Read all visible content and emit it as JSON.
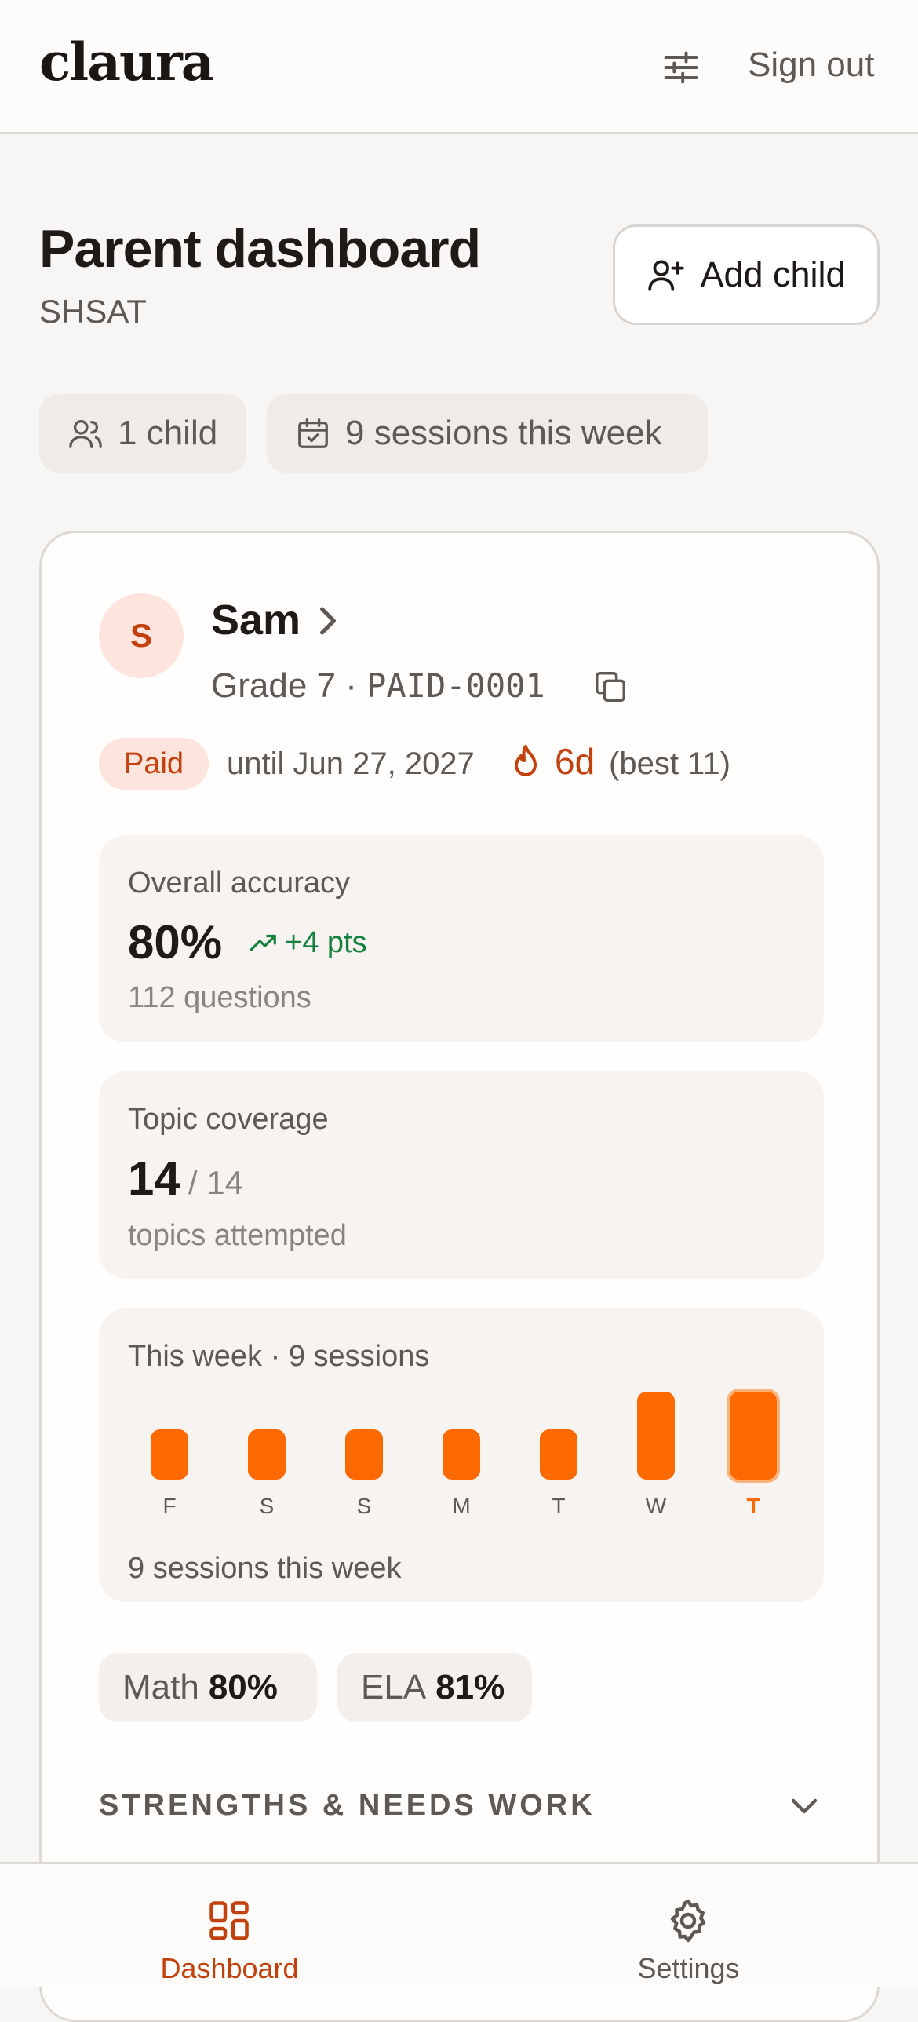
{
  "app": {
    "logo": "claura",
    "sign_out": "Sign out"
  },
  "header": {
    "title": "Parent dashboard",
    "subtitle": "SHSAT",
    "add_child_label": "Add child"
  },
  "summary": {
    "children": "1 child",
    "sessions": "9 sessions this week"
  },
  "child": {
    "initial": "S",
    "name": "Sam",
    "grade": "Grade 7",
    "separator": "·",
    "id": "PAID-0001",
    "badge": "Paid",
    "until": "until Jun 27, 2027",
    "streak": "6d",
    "best": "(best 11)"
  },
  "accuracy": {
    "label": "Overall accuracy",
    "value": "80%",
    "delta": "+4 pts",
    "sub": "112 questions"
  },
  "coverage": {
    "label": "Topic coverage",
    "value": "14",
    "total": "/ 14",
    "sub": "topics attempted"
  },
  "week": {
    "label": "This week · 9 sessions",
    "footer": "9 sessions this week",
    "days": [
      {
        "label": "F",
        "sessions": 1,
        "today": false
      },
      {
        "label": "S",
        "sessions": 1,
        "today": false
      },
      {
        "label": "S",
        "sessions": 1,
        "today": false
      },
      {
        "label": "M",
        "sessions": 1,
        "today": false
      },
      {
        "label": "T",
        "sessions": 1,
        "today": false
      },
      {
        "label": "W",
        "sessions": 2,
        "today": false
      },
      {
        "label": "T",
        "sessions": 2,
        "today": true
      }
    ]
  },
  "subjects": [
    {
      "name": "Math",
      "value": "80%"
    },
    {
      "name": "ELA",
      "value": "81%"
    }
  ],
  "strengths": {
    "label": "STRENGTHS & NEEDS WORK"
  },
  "nav": {
    "dashboard": "Dashboard",
    "settings": "Settings"
  },
  "colors": {
    "accent": "#ff6a00",
    "brand": "#c2410c",
    "positive": "#15803d",
    "muted": "#5f5955"
  }
}
